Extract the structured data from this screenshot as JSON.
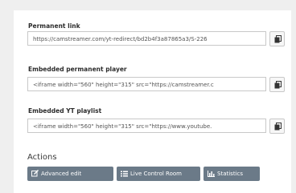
{
  "fields": [
    {
      "label": "Permanent link",
      "value": "https://camstreamer.com/yt-redirect/bd2b4f3a87865a3/S-226"
    },
    {
      "label": "Embedded permanent player",
      "value": "<iframe width=\"560\" height=\"315\" src=\"https://camstreamer.c"
    },
    {
      "label": "Embedded YT playlist",
      "value": "<iframe width=\"560\" height=\"315\" src=\"https://www.youtube."
    }
  ],
  "copy_icon": "clipboard-icon",
  "actions": {
    "title": "Actions",
    "buttons": [
      {
        "label": "Advanced edit",
        "icon": "edit-icon"
      },
      {
        "label": "Live Control Room",
        "icon": "list-icon"
      },
      {
        "label": "Statistics",
        "icon": "bar-chart-icon"
      }
    ]
  },
  "colors": {
    "background": "#efefef",
    "panel": "#ffffff",
    "action_button": "#6b7a88",
    "border": "#c8c8c8"
  }
}
